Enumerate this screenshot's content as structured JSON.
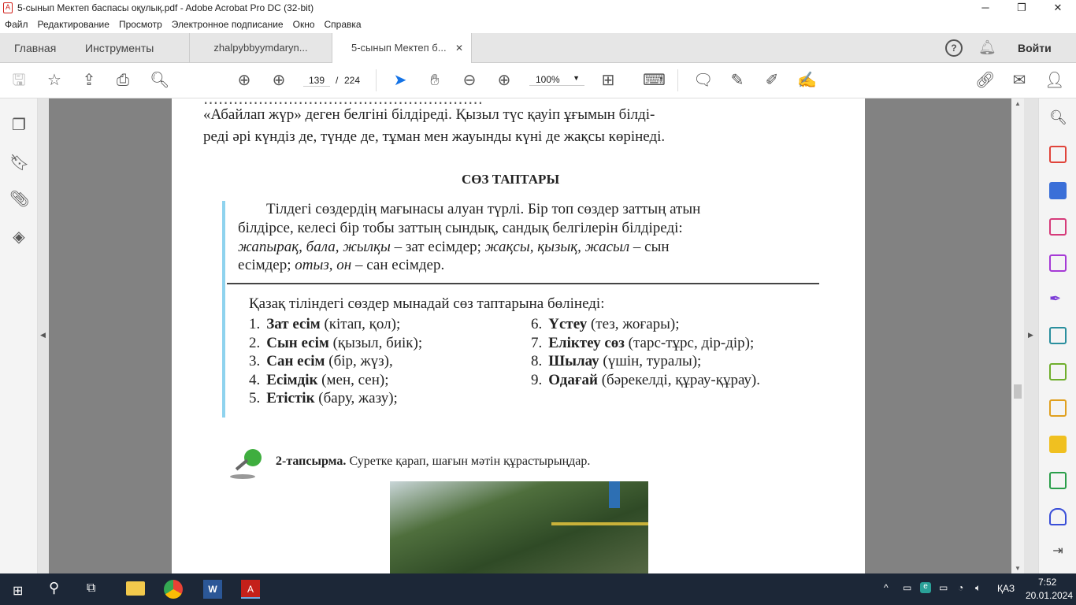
{
  "window": {
    "title": "5-сынып Мектеп баспасы оқулық.pdf - Adobe Acrobat Pro DC (32-bit)"
  },
  "menu": [
    "Файл",
    "Редактирование",
    "Просмотр",
    "Электронное подписание",
    "Окно",
    "Справка"
  ],
  "tabs": {
    "home": "Главная",
    "tools": "Инструменты",
    "doc1": "zhalpybbyymdaryn...",
    "doc2": "5-сынып Мектеп б...",
    "signin": "Войти"
  },
  "toolbar": {
    "page_current": "139",
    "page_sep": "/",
    "page_total": "224",
    "zoom": "100%"
  },
  "page": {
    "lines_top": [
      "«Абайлап  жүр»  деген белгіні  білдіреді.  Қызыл  түс қауіп  ұғымын  білді-",
      "реді  әрі күндіз  де, түнде де, тұман  мен жауынды   күні  де жақсы  көрінеді."
    ],
    "heading": "СӨЗ  ТАПТАРЫ",
    "intro": [
      "Тілдегі  сөздердің  мағынасы   алуан  түрлі.  Бір топ сөздер заттың  атын",
      "білдірсе,  келесі  бір тобы заттың  сындық,  сандық  белгілерін  білдіреді:"
    ],
    "intro3": {
      "i1": "жапырақ,  бала,  жылқы",
      "t1": " – зат  есімдер; ",
      "i2": "жақсы,  қызық,   жасыл",
      "t2": " – сын"
    },
    "intro4": {
      "t1": "есімдер;  ",
      "i1": "отыз,  он",
      "t2": " – сан  есімдер."
    },
    "list_intro": "Қазақ  тіліндегі   сөздер  мынадай   сөз  таптарына   бөлінеді:",
    "list": [
      {
        "n": "1.",
        "b": "Зат  есім",
        "r": " (кітап,   қол);"
      },
      {
        "n": "2.",
        "b": "Сын  есім",
        "r": " (қызыл,   биік);"
      },
      {
        "n": "3.",
        "b": "Сан  есім",
        "r": " (бір,  жүз),"
      },
      {
        "n": "4.",
        "b": "Есімдік",
        "r": "  (мен,  сен);"
      },
      {
        "n": "5.",
        "b": "Етістік",
        "r": " (бару,   жазу);"
      },
      {
        "n": "6.",
        "b": "Үстеу",
        "r": " (тез,  жоғары);"
      },
      {
        "n": "7.",
        "b": "Еліктеу  сөз",
        "r": " (тарс-тұрс,   дір-дір);"
      },
      {
        "n": "8.",
        "b": "Шылау",
        "r": " (үшін,  туралы);"
      },
      {
        "n": "9.",
        "b": "Одағай",
        "r": " (бәрекелді,   құрау-құрау)."
      }
    ],
    "task_label": "2-тапсырма.",
    "task_text": "  Суретке  қарап,  шағын  мәтін  құрастырыңдар."
  },
  "taskbar": {
    "lang": "ҚАЗ",
    "time": "7:52",
    "date": "20.01.2024"
  },
  "colors": {
    "accent": "#1473e6",
    "taskbar": "#1c2737",
    "doc_bg": "#828282"
  }
}
